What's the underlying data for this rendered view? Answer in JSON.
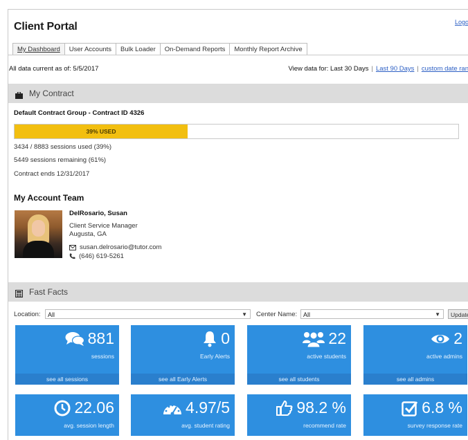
{
  "header": {
    "title": "Client Portal",
    "logout": "Logo"
  },
  "tabs": [
    {
      "label": "My Dashboard",
      "active": true
    },
    {
      "label": "User Accounts"
    },
    {
      "label": "Bulk Loader"
    },
    {
      "label": "On-Demand Reports"
    },
    {
      "label": "Monthly Report Archive"
    }
  ],
  "status": {
    "data_current": "All data current as of: 5/5/2017",
    "view_for_label": "View data for: Last 30 Days",
    "last_90": "Last 90 Days",
    "custom_range": "custom date ran"
  },
  "contract": {
    "section_title": "My Contract",
    "group": "Default Contract Group - Contract ID 4326",
    "progress_label": "39% USED",
    "progress_fraction": 0.39,
    "sessions_used": "3434 / 8883 sessions used (39%)",
    "sessions_remaining": "5449 sessions remaining (61%)",
    "ends": "Contract ends 12/31/2017"
  },
  "team": {
    "title": "My Account Team",
    "name": "DelRosario, Susan",
    "role": "Client Service Manager",
    "location": "Augusta, GA",
    "email": "susan.delrosario@tutor.com",
    "phone": "(646) 619-5261"
  },
  "fast_facts": {
    "section_title": "Fast Facts",
    "location_label": "Location:",
    "location_value": "All",
    "center_label": "Center Name:",
    "center_value": "All",
    "update_label": "Update",
    "cards": [
      {
        "value": "881",
        "label": "sessions",
        "link": "see all sessions",
        "icon": "comments-icon"
      },
      {
        "value": "0",
        "label": "Early Alerts",
        "link": "see all Early Alerts",
        "icon": "bell-icon"
      },
      {
        "value": "22",
        "label": "active students",
        "link": "see all students",
        "icon": "users-icon"
      },
      {
        "value": "2",
        "label": "active admins",
        "link": "see all admins",
        "icon": "eye-icon"
      },
      {
        "value": "22.06",
        "label": "avg. session length",
        "icon": "clock-icon"
      },
      {
        "value": "4.97/5",
        "label": "avg. student rating",
        "icon": "gauge-icon"
      },
      {
        "value": "98.2 %",
        "label": "recommend rate",
        "icon": "thumbs-up-icon"
      },
      {
        "value": "6.8 %",
        "label": "survey response rate",
        "icon": "check-square-icon"
      }
    ]
  },
  "colors": {
    "card_blue": "#2e8fe0",
    "progress_yellow": "#f2bf10",
    "section_grey": "#dcdcdc",
    "link_blue": "#2c5fc4"
  }
}
